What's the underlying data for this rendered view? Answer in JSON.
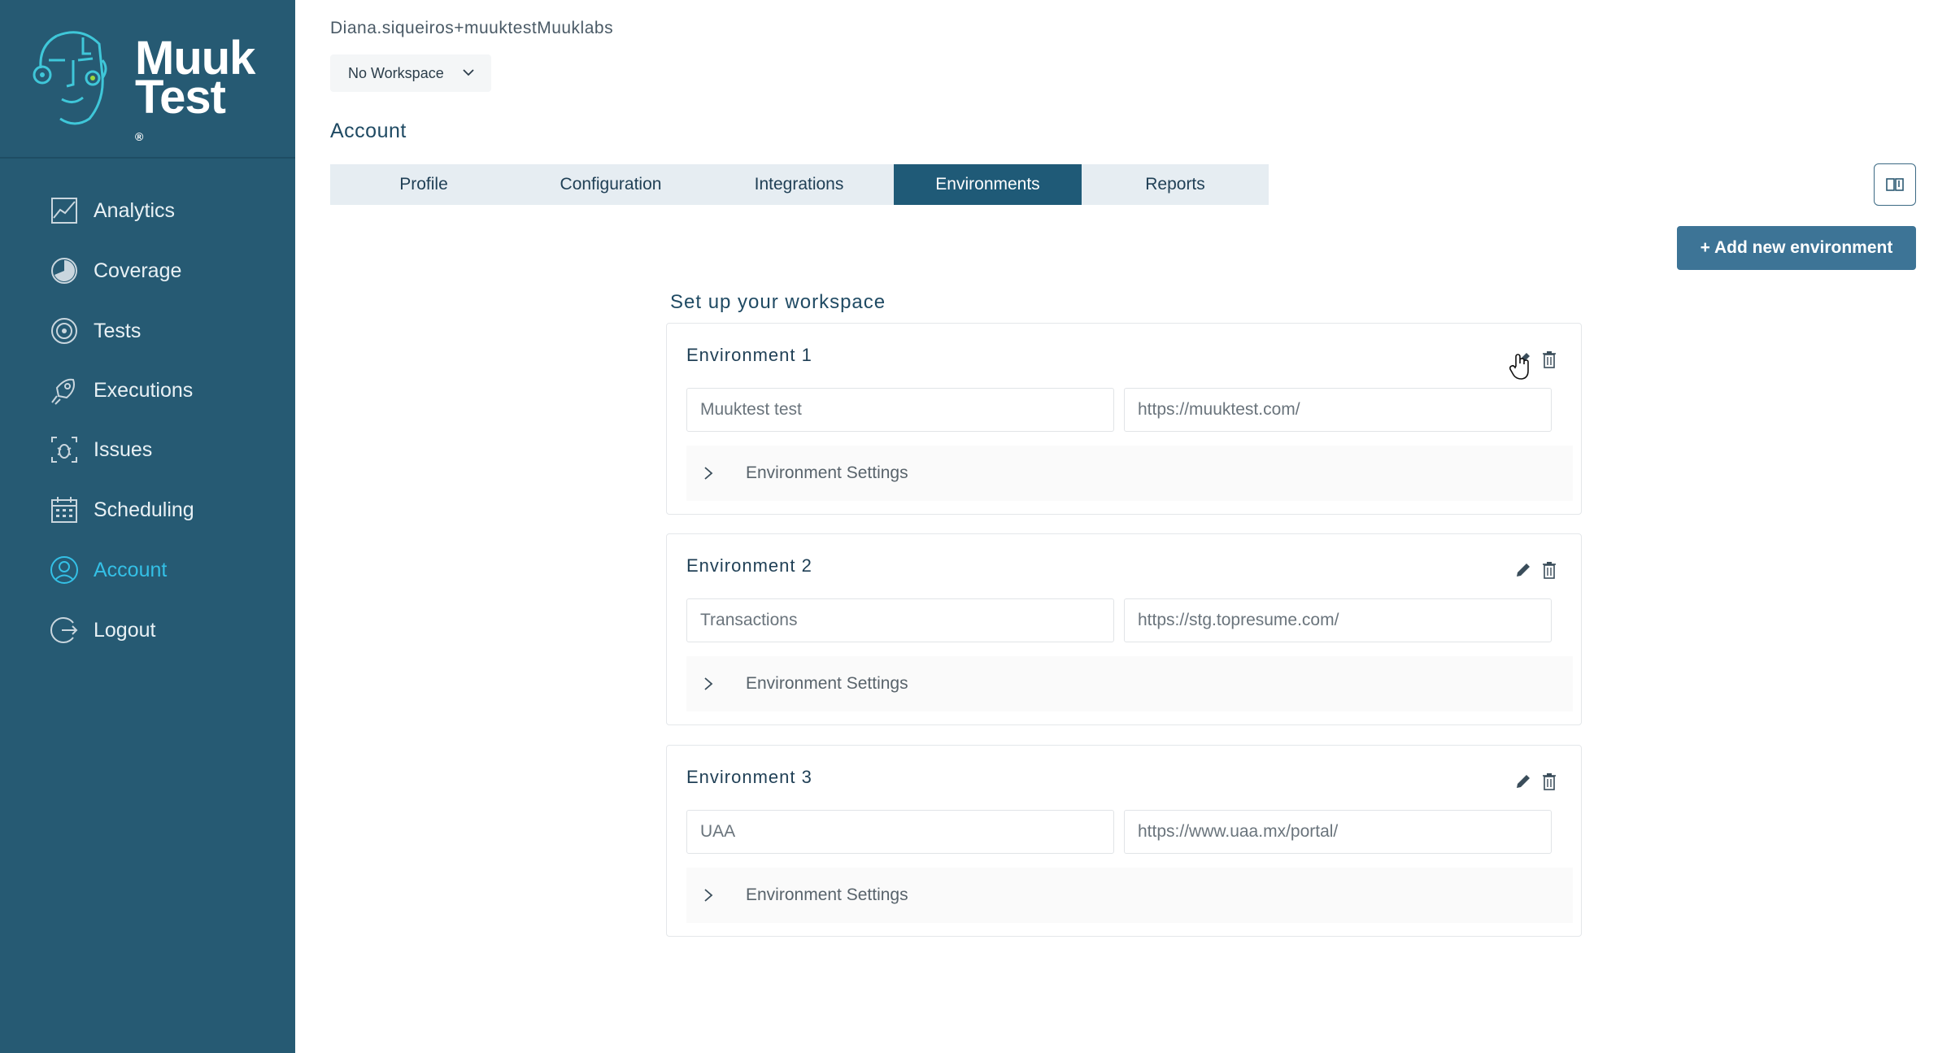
{
  "brand": {
    "line1": "Muuk",
    "line2": "Test",
    "mark": "®"
  },
  "sidebar": {
    "items": [
      {
        "label": "Analytics",
        "icon": "analytics-icon",
        "active": false
      },
      {
        "label": "Coverage",
        "icon": "coverage-icon",
        "active": false
      },
      {
        "label": "Tests",
        "icon": "tests-icon",
        "active": false
      },
      {
        "label": "Executions",
        "icon": "rocket-icon",
        "active": false
      },
      {
        "label": "Issues",
        "icon": "bug-icon",
        "active": false
      },
      {
        "label": "Scheduling",
        "icon": "calendar-icon",
        "active": false
      },
      {
        "label": "Account",
        "icon": "user-icon",
        "active": true
      },
      {
        "label": "Logout",
        "icon": "logout-icon",
        "active": false
      }
    ]
  },
  "header": {
    "user": "Diana.siqueiros+muuktestMuuklabs",
    "workspace": "No Workspace",
    "section": "Account"
  },
  "tabs": [
    {
      "label": "Profile",
      "active": false
    },
    {
      "label": "Configuration",
      "active": false
    },
    {
      "label": "Integrations",
      "active": false
    },
    {
      "label": "Environments",
      "active": true
    },
    {
      "label": "Reports",
      "active": false
    }
  ],
  "actions": {
    "add_environment": "+ Add new environment"
  },
  "workspace_title": "Set up your workspace",
  "environments": [
    {
      "title": "Environment 1",
      "name": "Muuktest test",
      "url": "https://muuktest.com/",
      "settings_label": "Environment Settings"
    },
    {
      "title": "Environment 2",
      "name": "Transactions",
      "url": "https://stg.topresume.com/",
      "settings_label": "Environment Settings"
    },
    {
      "title": "Environment 3",
      "name": "UAA",
      "url": "https://www.uaa.mx/portal/",
      "settings_label": "Environment Settings"
    }
  ],
  "colors": {
    "sidebar_bg": "#265a73",
    "active_nav": "#34c0e6",
    "active_tab": "#1f5a77",
    "primary_button": "#3d7496"
  }
}
